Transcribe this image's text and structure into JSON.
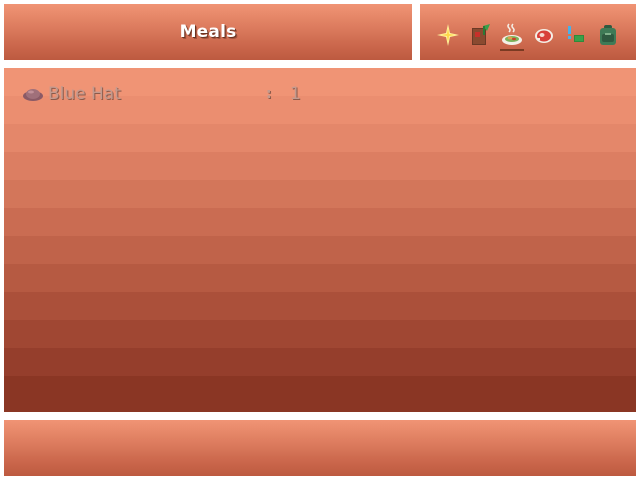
{
  "title_window": {
    "title": "Meals"
  },
  "category_window": {
    "tabs": [
      {
        "icon": "sparkle-icon",
        "selected": false
      },
      {
        "icon": "spellbook-icon",
        "selected": false
      },
      {
        "icon": "steaming-meal-icon",
        "selected": true
      },
      {
        "icon": "meat-icon",
        "selected": false
      },
      {
        "icon": "key-item-icon",
        "selected": false
      },
      {
        "icon": "backpack-icon",
        "selected": false
      }
    ]
  },
  "item_list": {
    "items": [
      {
        "icon": "hat-icon",
        "name": "Blue Hat",
        "separator": ":",
        "quantity": "1"
      }
    ]
  },
  "help_window": {
    "text": ""
  },
  "colors": {
    "window_top": "#f09475",
    "window_bottom": "#8a3624",
    "item_text_disabled": "#c49a8e",
    "title_text": "#ffffff"
  }
}
